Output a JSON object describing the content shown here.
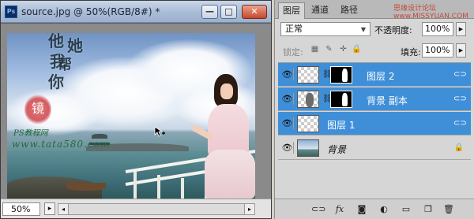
{
  "document": {
    "title": "source.jpg @ 50%(RGB/8#) *",
    "app_icon": "Ps",
    "zoom": "50%",
    "window_buttons": {
      "minimize": "—",
      "maximize": "□",
      "close": "✕"
    },
    "canvas_text": {
      "calligraphy": [
        "他",
        "她",
        "我",
        "帮",
        "你"
      ],
      "seal": "镜",
      "watermark_1": "PS教程网",
      "watermark_2": "www.tata580.com"
    }
  },
  "panel": {
    "tabs": [
      "图层",
      "通道",
      "路径"
    ],
    "site_watermark": "思缘设计论坛 www.MISSYUAN.COM",
    "blend_mode": "正常",
    "opacity_label": "不透明度:",
    "opacity_value": "100%",
    "lock_label": "锁定:",
    "fill_label": "填充:",
    "fill_value": "100%",
    "layers": [
      {
        "name": "图层 2",
        "selected": true,
        "has_mask": true
      },
      {
        "name": "背景 副本",
        "selected": true,
        "has_mask": true
      },
      {
        "name": "图层 1",
        "selected": true,
        "has_mask": false
      },
      {
        "name": "背景",
        "selected": false,
        "has_mask": false,
        "locked": true
      }
    ],
    "footer_icons": [
      "link-layers-icon",
      "fx-icon",
      "add-mask-icon",
      "adjustment-layer-icon",
      "new-group-icon",
      "new-layer-icon",
      "trash-icon"
    ]
  },
  "colors": {
    "selection_blue": "#3f8fd8",
    "panel_bg": "#d6d6d6",
    "titlebar": "#a9bcd6",
    "close_red": "#c5482b"
  }
}
